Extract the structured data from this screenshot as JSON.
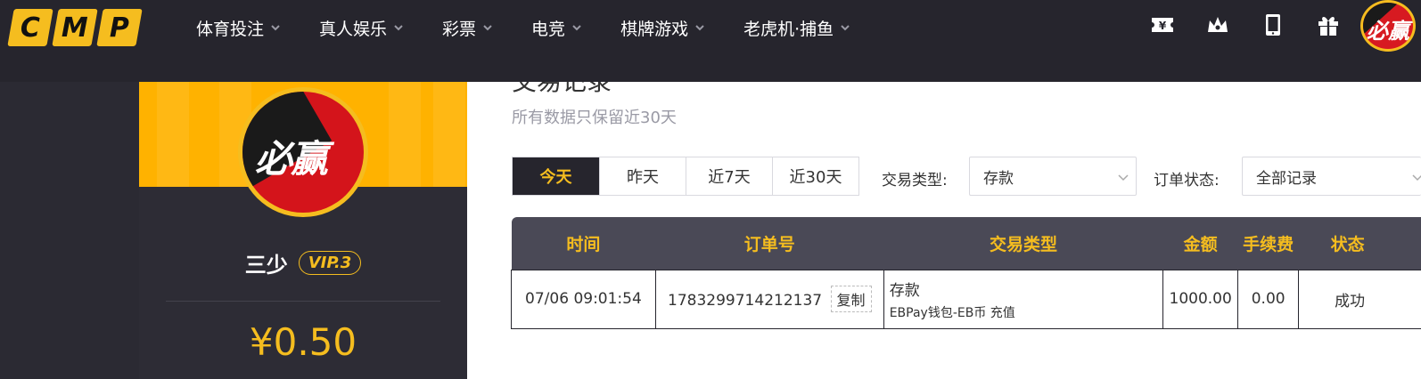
{
  "logo": {
    "letters": [
      "C",
      "M",
      "P"
    ]
  },
  "nav": {
    "items": [
      {
        "label": "体育投注"
      },
      {
        "label": "真人娱乐"
      },
      {
        "label": "彩票"
      },
      {
        "label": "电竞"
      },
      {
        "label": "棋牌游戏"
      },
      {
        "label": "老虎机·捕鱼"
      }
    ],
    "icons": [
      "ticket-icon",
      "crown-icon",
      "tablet-icon",
      "gift-icon"
    ],
    "avatar_text": "必赢"
  },
  "profile": {
    "avatar_text": "必赢",
    "username": "三少",
    "vip": "VIP.3",
    "balance": "¥0.50"
  },
  "main": {
    "title": "交易记录",
    "retention_note": "所有数据只保留近30天",
    "date_tabs": [
      {
        "label": "今天",
        "active": true
      },
      {
        "label": "昨天",
        "active": false
      },
      {
        "label": "近7天",
        "active": false
      },
      {
        "label": "近30天",
        "active": false
      }
    ],
    "filters": {
      "type_label": "交易类型:",
      "type_value": "存款",
      "status_label": "订单状态:",
      "status_value": "全部记录"
    },
    "table": {
      "headers": [
        "时间",
        "订单号",
        "交易类型",
        "金额",
        "手续费",
        "状态"
      ],
      "rows": [
        {
          "time": "07/06 09:01:54",
          "order_no": "1783299714212137",
          "copy_label": "复制",
          "type_main": "存款",
          "type_sub": "EBPay钱包-EB币 充值",
          "amount": "1000.00",
          "fee": "0.00",
          "status": "成功"
        }
      ]
    }
  },
  "colors": {
    "accent": "#f5bd1f",
    "nav_bg": "#26252d",
    "success": "#3aa83a"
  }
}
